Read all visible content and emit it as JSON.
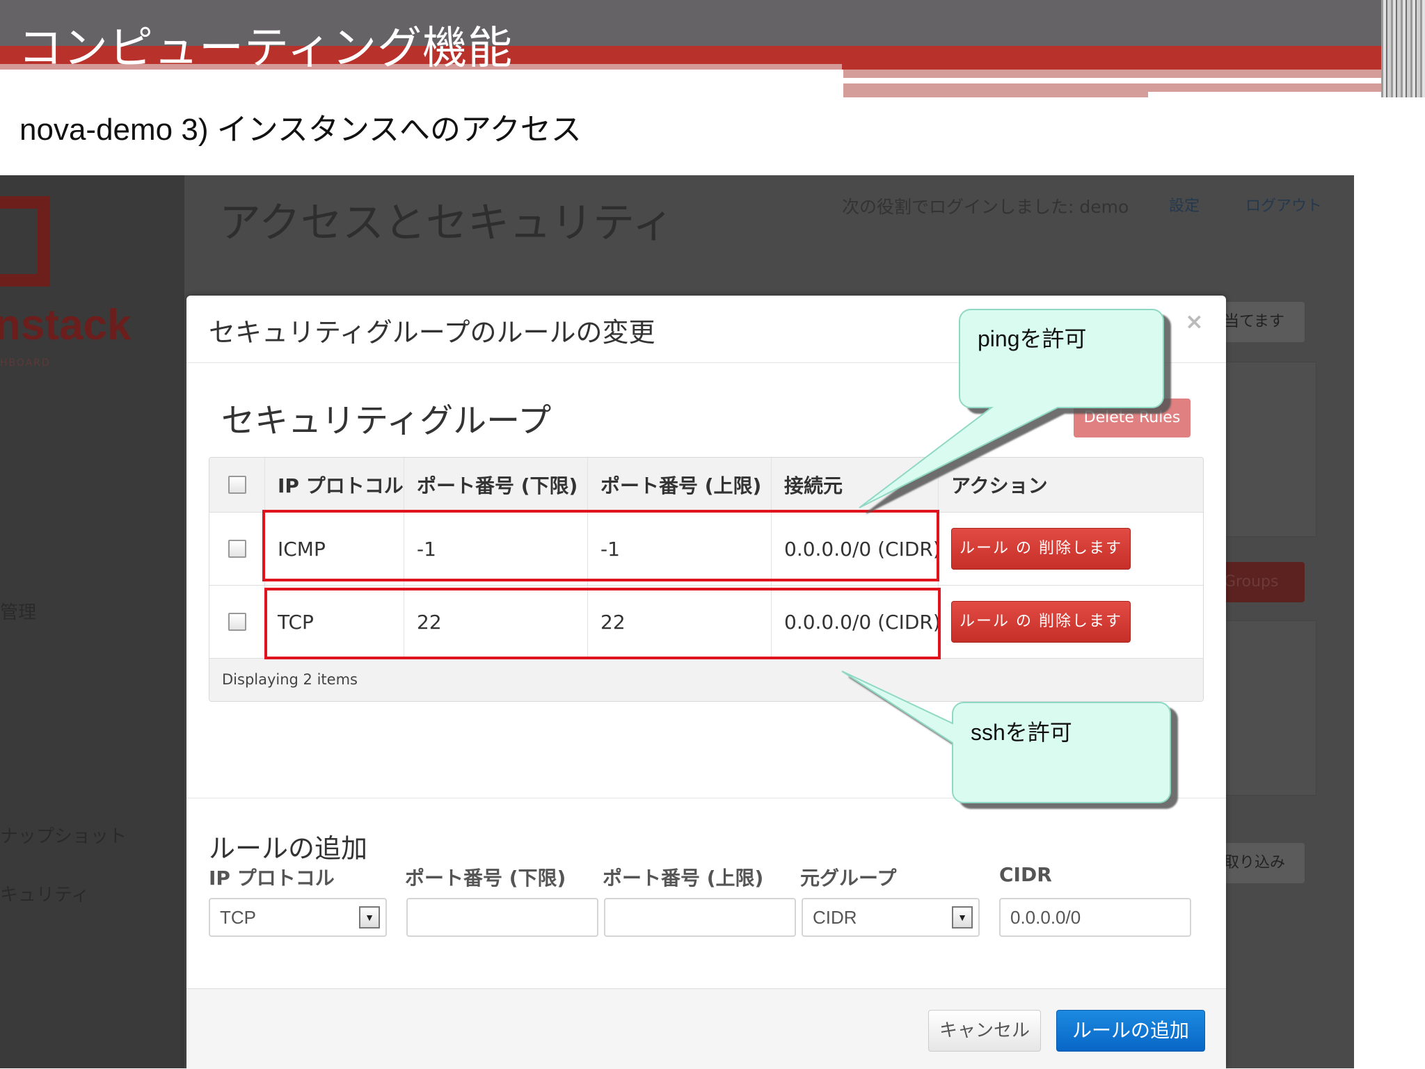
{
  "slide": {
    "title": "コンピューティング機能",
    "subtitle": "nova-demo 3) インスタンスへのアクセス"
  },
  "background": {
    "logo_text": "nstack",
    "logo_sub": "HBOARD",
    "page_title": "アクセスとセキュリティ",
    "login_text": "次の役割でログインしました: demo",
    "settings_link": "設定",
    "logout_link": "ログアウト",
    "sidebar_items": [
      "管理",
      "ナップショット",
      "キュリティ"
    ],
    "right_buttons": [
      "当てます",
      "Groups",
      "取り込み"
    ]
  },
  "modal": {
    "title": "セキュリティグループのルールの変更",
    "close": "×",
    "section_title": "セキュリティグループ",
    "delete_rules": "Delete Rules",
    "table": {
      "headers": [
        "IP プロトコル",
        "ポート番号 (下限)",
        "ポート番号 (上限)",
        "接続元",
        "アクション"
      ],
      "rows": [
        {
          "protocol": "ICMP",
          "from_port": "-1",
          "to_port": "-1",
          "source": "0.0.0.0/0 (CIDR)",
          "action": "ルール の 削除します"
        },
        {
          "protocol": "TCP",
          "from_port": "22",
          "to_port": "22",
          "source": "0.0.0.0/0 (CIDR)",
          "action": "ルール の 削除します"
        }
      ],
      "footer": "Displaying 2 items"
    },
    "add_rule": {
      "title": "ルールの追加",
      "labels": [
        "IP プロトコル",
        "ポート番号 (下限)",
        "ポート番号 (上限)",
        "元グループ",
        "CIDR"
      ],
      "protocol_value": "TCP",
      "from_port_value": "",
      "to_port_value": "",
      "source_group_value": "CIDR",
      "cidr_value": "0.0.0.0/0"
    },
    "cancel_label": "キャンセル",
    "submit_label": "ルールの追加"
  },
  "callouts": {
    "ping": "pingを許可",
    "ssh": "sshを許可"
  },
  "colors": {
    "slide_band": "#b8312b",
    "highlight_box": "#e0141e",
    "callout_fill": "#d9fbf0",
    "primary_button": "#0866c6",
    "danger_button": "#c62f28"
  }
}
